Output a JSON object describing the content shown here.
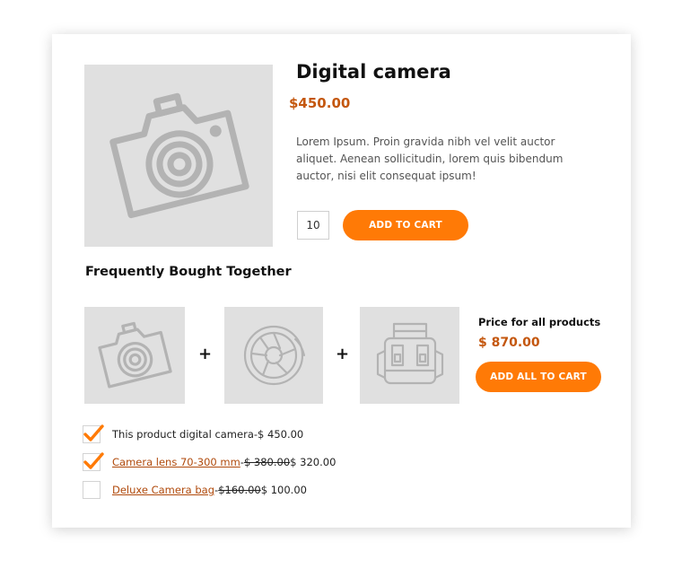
{
  "product": {
    "title": "Digital camera",
    "price": "$450.00",
    "description": "Lorem Ipsum. Proin gravida nibh vel velit auctor aliquet. Aenean sollicitudin, lorem quis bibendum auctor, nisi elit consequat ipsum!",
    "quantity": "10",
    "add_to_cart_label": "ADD TO CART"
  },
  "bundle": {
    "title": "Frequently Bought Together",
    "plus_sign": "+",
    "total_label": "Price for all products",
    "total_price": "$ 870.00",
    "add_all_label": "ADD ALL TO CART",
    "items": [
      {
        "checked": true,
        "name": "This product digital camera",
        "separator": " - ",
        "old_price": "",
        "price": "$ 450.00",
        "is_link": false,
        "icon": "camera-icon"
      },
      {
        "checked": true,
        "name": "Camera lens 70-300 mm",
        "separator": " - ",
        "old_price": "$ 380.00",
        "price": " $ 320.00",
        "is_link": true,
        "icon": "camera-lens-icon"
      },
      {
        "checked": false,
        "name": "Deluxe Camera bag",
        "separator": " - ",
        "old_price": "$160.00",
        "price": " $ 100.00",
        "is_link": true,
        "icon": "camera-bag-icon"
      }
    ]
  },
  "colors": {
    "accent": "#ff7a06",
    "price": "#c4570e",
    "placeholder_bg": "#e0e0e0",
    "icon_stroke": "#b0b0b0"
  }
}
